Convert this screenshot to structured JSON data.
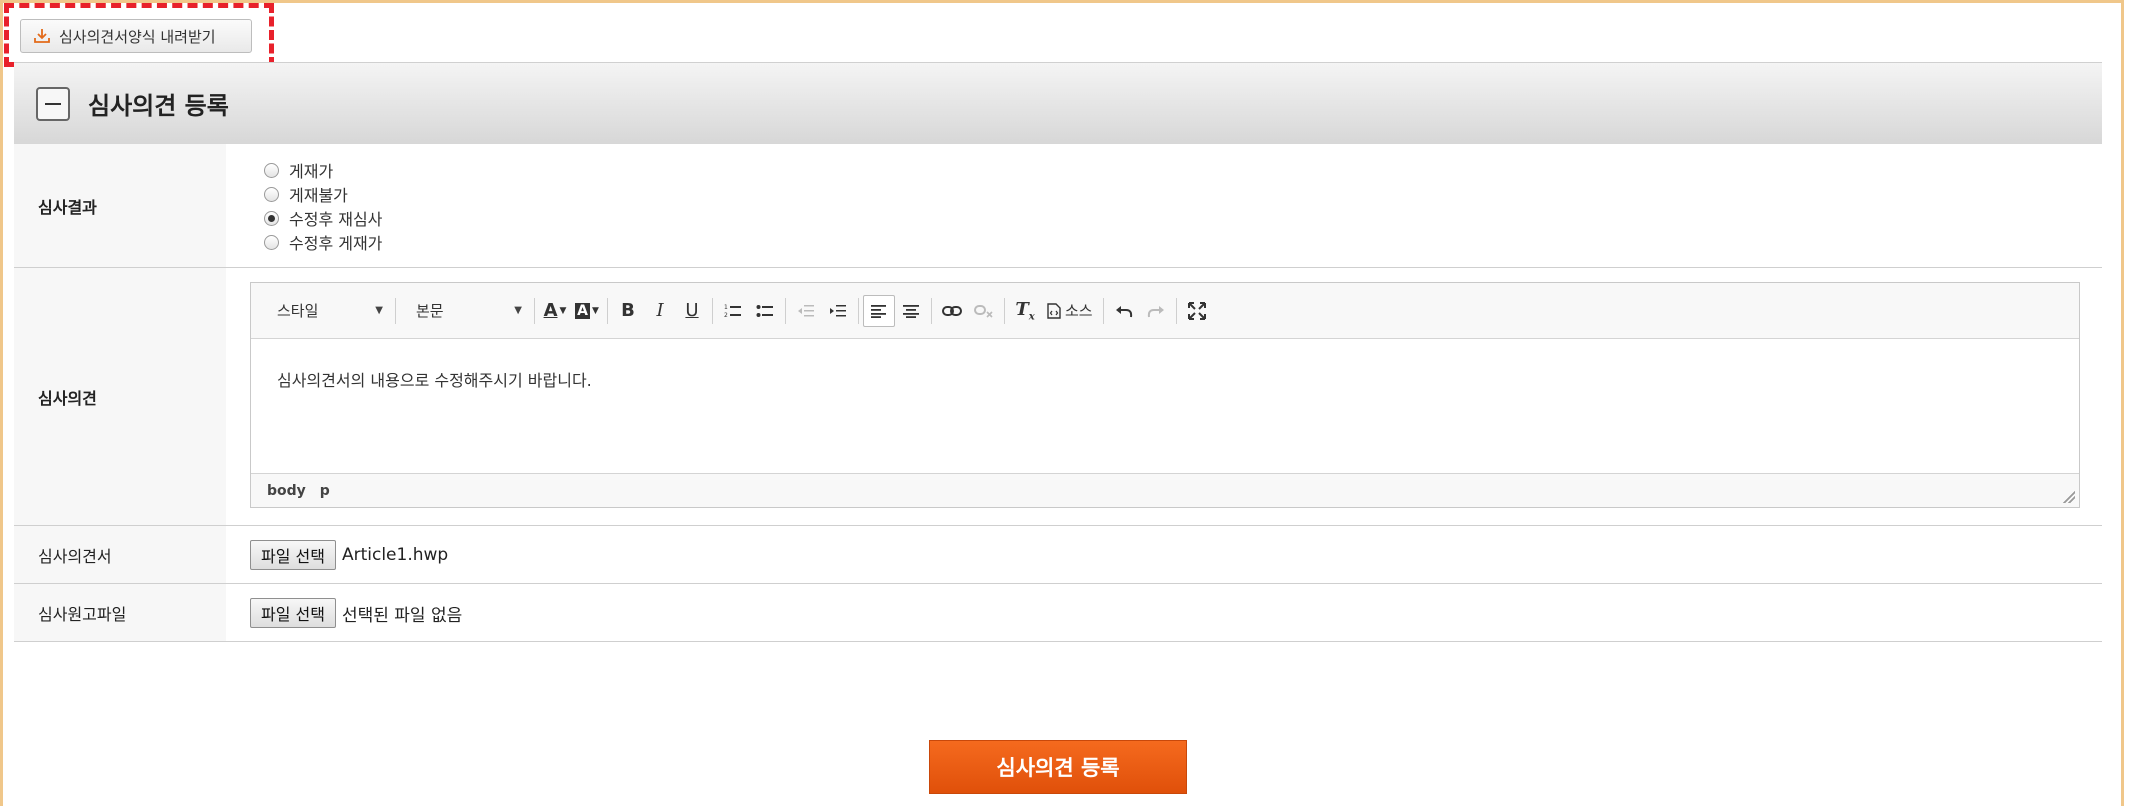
{
  "download_button": {
    "label": "심사의견서양식 내려받기",
    "icon": "download-icon"
  },
  "section": {
    "title": "심사의견 등록",
    "toggle_icon": "minus-icon"
  },
  "review_result": {
    "label": "심사결과",
    "options": [
      {
        "label": "게재가",
        "checked": false
      },
      {
        "label": "게재불가",
        "checked": false
      },
      {
        "label": "수정후 재심사",
        "checked": true
      },
      {
        "label": "수정후 게재가",
        "checked": false
      }
    ]
  },
  "review_opinion": {
    "label": "심사의견",
    "editor": {
      "style_combo": "스타일",
      "format_combo": "본문",
      "source_label": "소스",
      "content": "심사의견서의 내용으로 수정해주시기 바랍니다.",
      "path": [
        "body",
        "p"
      ]
    }
  },
  "review_form_file": {
    "label": "심사의견서",
    "button": "파일 선택",
    "file_name": "Article1.hwp"
  },
  "review_manuscript_file": {
    "label": "심사원고파일",
    "button": "파일 선택",
    "file_name": "선택된 파일 없음"
  },
  "submit": {
    "label": "심사의견 등록"
  },
  "colors": {
    "accent": "#e8212b",
    "submit": "#f05a12",
    "frame": "#f0c78a"
  }
}
